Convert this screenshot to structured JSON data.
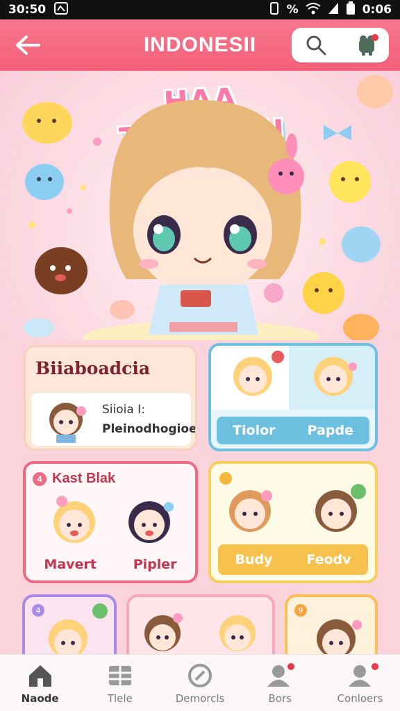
{
  "status_bar": {
    "time": "30:50",
    "battery": "%",
    "right_time": "0:06"
  },
  "header": {
    "title": "INDONESII"
  },
  "hero": {
    "title": "HAA TUOPEAH"
  },
  "cards": {
    "card1": {
      "title": "Biiaboadcia",
      "line1": "Siioia I:",
      "line2": "Pleinodhogioe"
    },
    "card2": {
      "left_label": "Tiolor",
      "right_label": "Papde"
    },
    "card3": {
      "badge": "4",
      "title": "Kast Blak",
      "left_label": "Mavert",
      "right_label": "Pipler"
    },
    "card4": {
      "left_label": "Budy",
      "right_label": "Feodv"
    },
    "card5": {
      "badge": "4"
    },
    "card7": {
      "badge": "9"
    }
  },
  "nav": {
    "items": [
      {
        "label": "Naode",
        "icon": "home-icon"
      },
      {
        "label": "Tlele",
        "icon": "grid-icon"
      },
      {
        "label": "Demorcls",
        "icon": "compass-icon"
      },
      {
        "label": "Bors",
        "icon": "profile-icon"
      },
      {
        "label": "Conloers",
        "icon": "user-icon"
      }
    ]
  },
  "colors": {
    "accent": "#f45f79",
    "background": "#fbd3dc",
    "blue": "#6dbfe0",
    "yellow": "#f6c24d"
  }
}
